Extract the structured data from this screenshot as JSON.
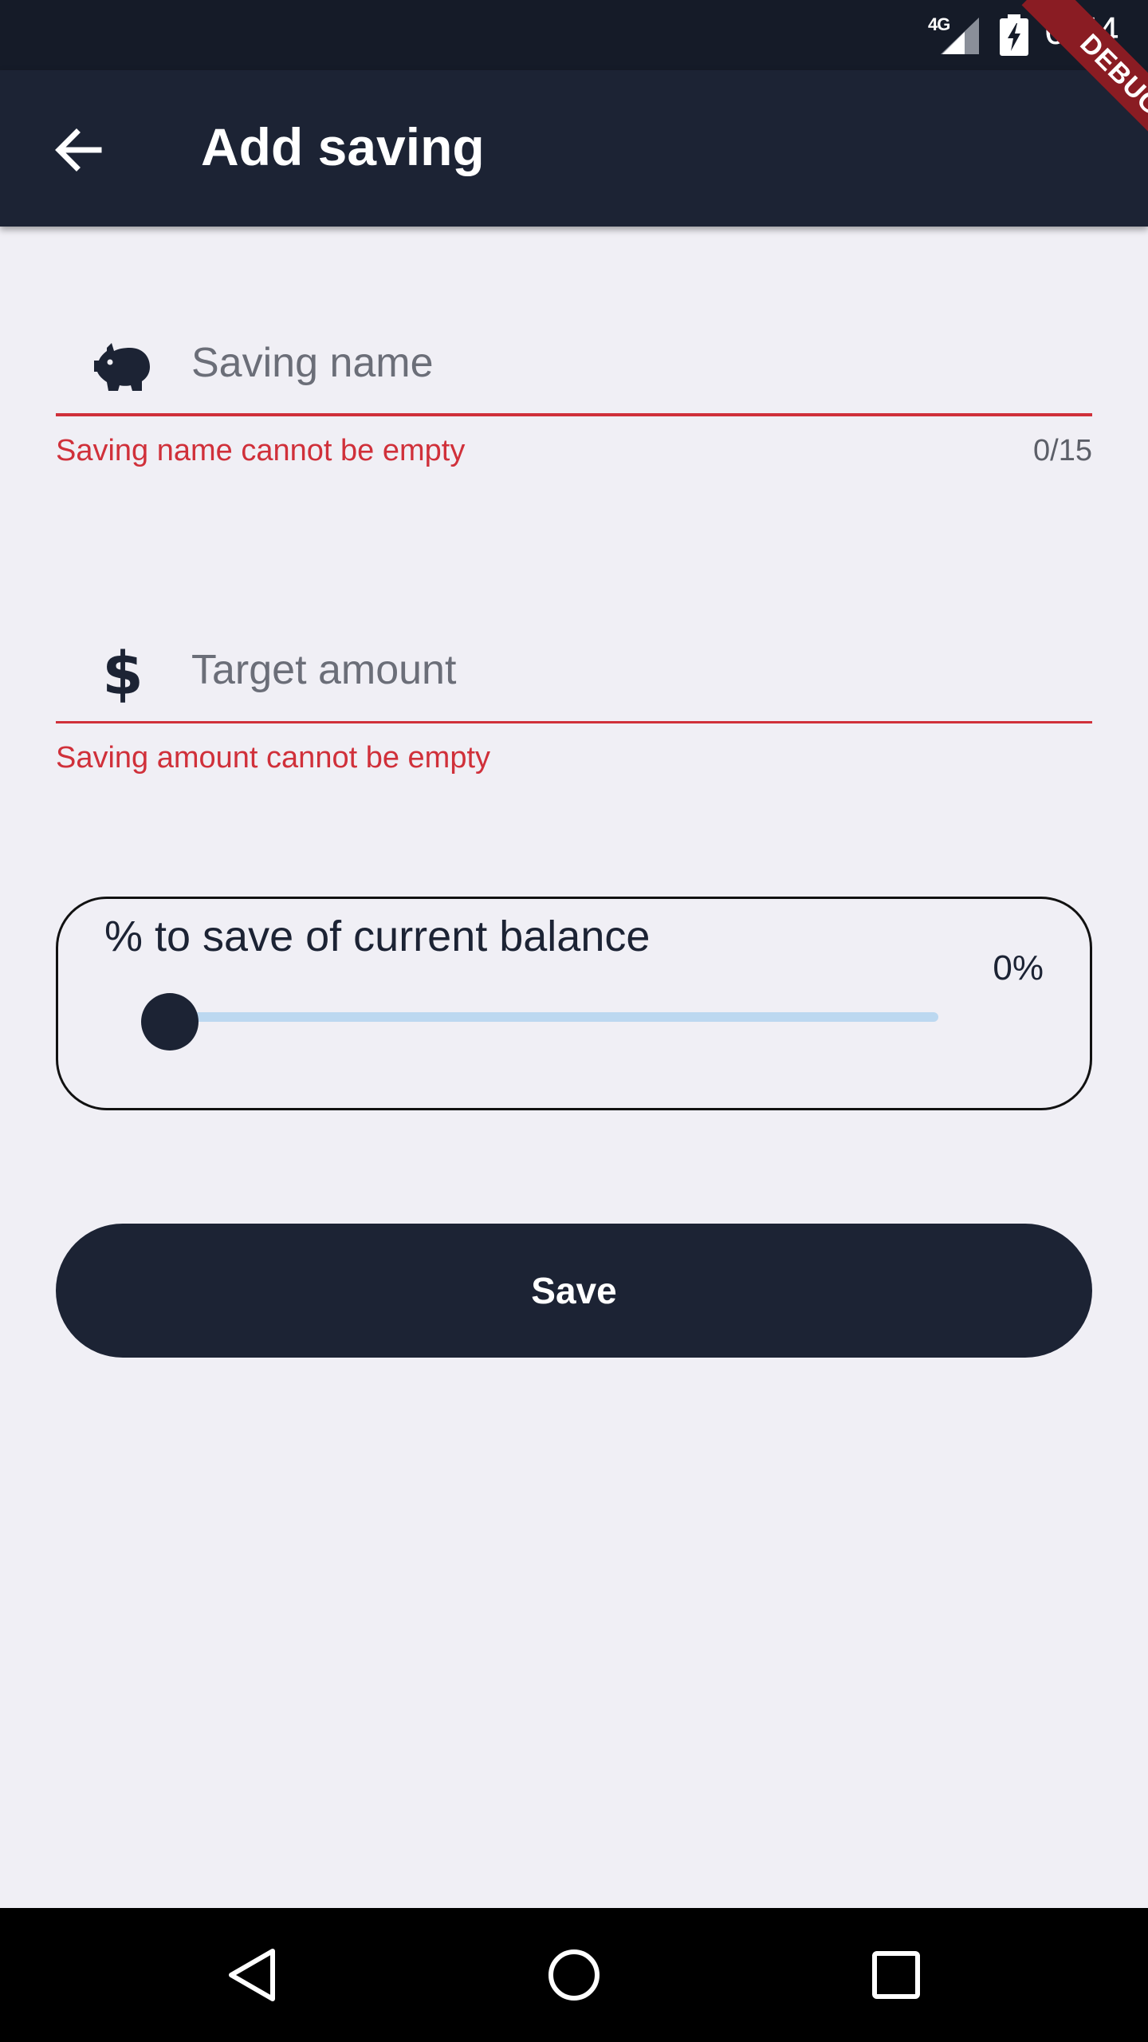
{
  "status_bar": {
    "network": "4G",
    "time": "6:54"
  },
  "debug_banner": "DEBUG",
  "app_bar": {
    "title": "Add saving",
    "back_icon": "arrow-back-icon"
  },
  "form": {
    "saving_name": {
      "icon": "piggy-bank-icon",
      "placeholder": "Saving name",
      "value": "",
      "error": "Saving name cannot be empty",
      "counter": "0/15"
    },
    "target_amount": {
      "icon": "dollar-icon",
      "icon_glyph": "$",
      "placeholder": "Target amount",
      "value": "",
      "error": "Saving amount cannot be empty"
    },
    "percent": {
      "label": "% to save of current balance",
      "value_text": "0%",
      "value": 0
    },
    "save_label": "Save"
  },
  "colors": {
    "primary": "#1c2334",
    "error": "#d0303a",
    "background": "#f0eff5",
    "slider_track": "#bcd8f0"
  },
  "nav_bar": {
    "icons": [
      "back-triangle-icon",
      "home-circle-icon",
      "recents-square-icon"
    ]
  }
}
